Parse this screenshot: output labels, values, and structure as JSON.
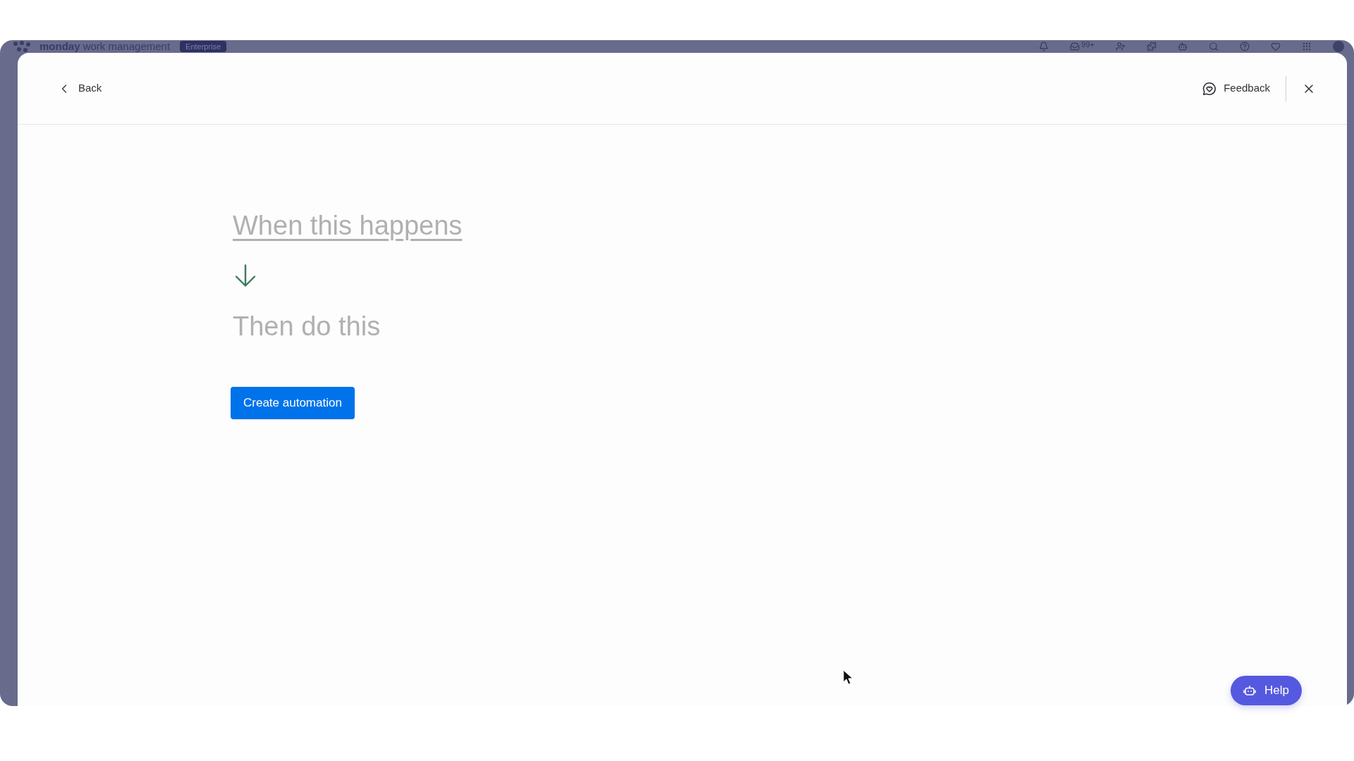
{
  "app_header": {
    "logo_text": "**monday** work management",
    "plan_badge": "Enterprise",
    "inbox_count": "99+"
  },
  "modal": {
    "back": "Back",
    "feedback": "Feedback"
  },
  "steps": [
    {
      "label": "When this happens",
      "disabled": false
    },
    {
      "label": "Then do this",
      "disabled": true
    }
  ],
  "primary_button": "Create automation",
  "help_button": "Help"
}
